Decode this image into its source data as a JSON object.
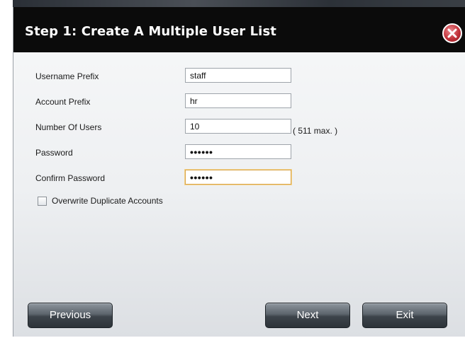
{
  "dialog": {
    "title": "Step 1: Create A Multiple User List"
  },
  "form": {
    "username_prefix": {
      "label": "Username Prefix",
      "value": "staff"
    },
    "account_prefix": {
      "label": "Account Prefix",
      "value": "hr"
    },
    "number_of_users": {
      "label": "Number Of Users",
      "value": "10",
      "hint": "( 511 max. )"
    },
    "password": {
      "label": "Password",
      "value": "••••••"
    },
    "confirm_password": {
      "label": "Confirm Password",
      "value": "••••••"
    },
    "overwrite": {
      "label": "Overwrite Duplicate Accounts",
      "checked": false
    }
  },
  "buttons": {
    "previous": "Previous",
    "next": "Next",
    "exit": "Exit"
  },
  "icons": {
    "close": "close-icon"
  },
  "colors": {
    "titlebar": "#0b0b0b",
    "close_button": "#c2323a",
    "focus_border": "#d9a54a"
  }
}
